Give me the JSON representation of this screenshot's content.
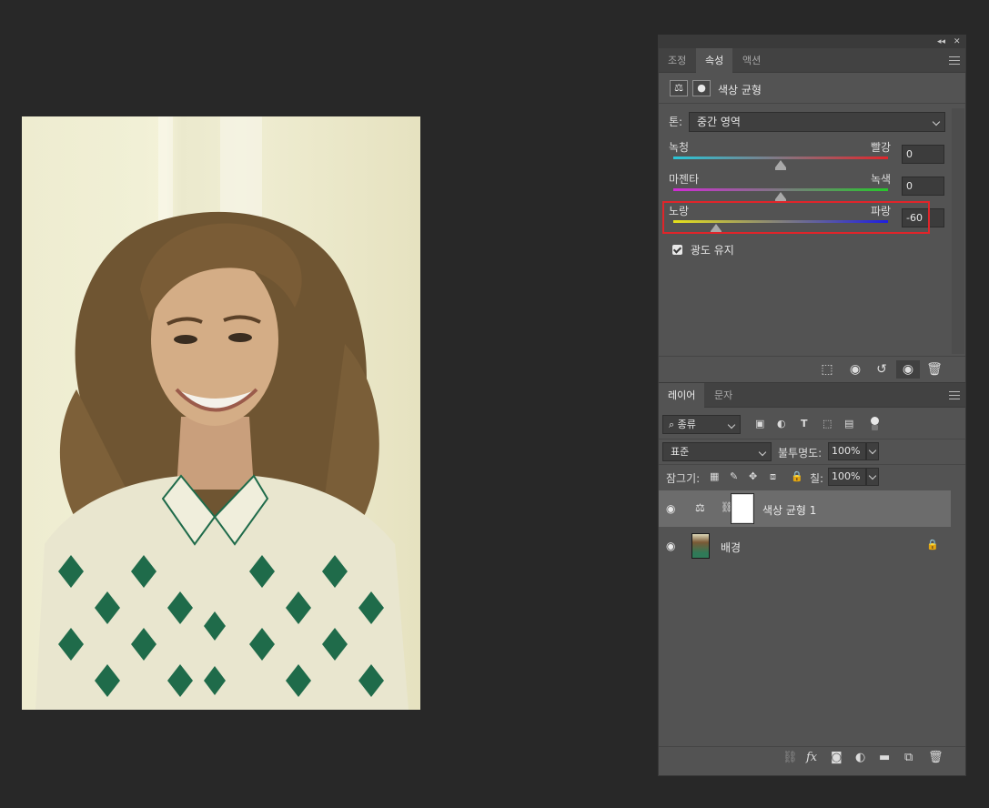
{
  "canvas": {
    "image_description_icon": "portrait-photo"
  },
  "panel": {
    "top_controls": {
      "collapse": "◂◂",
      "close": "✕"
    },
    "tabs": [
      {
        "label": "조정",
        "active": false
      },
      {
        "label": "속성",
        "active": true
      },
      {
        "label": "액션",
        "active": false
      }
    ],
    "header": {
      "title": "색상 균형",
      "icon1": "color-balance-icon",
      "icon2": "mask-icon"
    },
    "tone": {
      "label": "톤:",
      "value": "중간 영역"
    },
    "sliders": [
      {
        "left": "녹청",
        "right": "빨강",
        "value": "0",
        "position": 0.5,
        "gradient": [
          "#29c6d8",
          "#e0262b"
        ]
      },
      {
        "left": "마젠타",
        "right": "녹색",
        "value": "0",
        "position": 0.5,
        "gradient": [
          "#d12bd6",
          "#27c72b"
        ]
      },
      {
        "left": "노랑",
        "right": "파랑",
        "value": "-60",
        "position": 0.2,
        "gradient": [
          "#e6e21a",
          "#1e1ee0"
        ]
      }
    ],
    "preserve_luminosity": {
      "label": "광도 유지",
      "checked": true
    },
    "footer_icons": [
      "clip-to-layer-icon",
      "view-previous-icon",
      "reset-icon",
      "visibility-icon",
      "trash-icon"
    ]
  },
  "layers_panel": {
    "tabs": [
      {
        "label": "레이어",
        "active": true
      },
      {
        "label": "문자",
        "active": false
      }
    ],
    "filter": {
      "kind": "종류"
    },
    "blend_mode": "표준",
    "opacity_label": "불투명도:",
    "opacity": "100%",
    "lock_label": "잠그기:",
    "fill_label": "칠:",
    "fill": "100%",
    "layers": [
      {
        "name": "색상 균형 1",
        "selected": true
      },
      {
        "name": "배경",
        "selected": false,
        "locked": true
      }
    ]
  },
  "colors": {
    "highlight": "#e0252a",
    "panel_bg": "#535353",
    "app_bg": "#282828"
  }
}
